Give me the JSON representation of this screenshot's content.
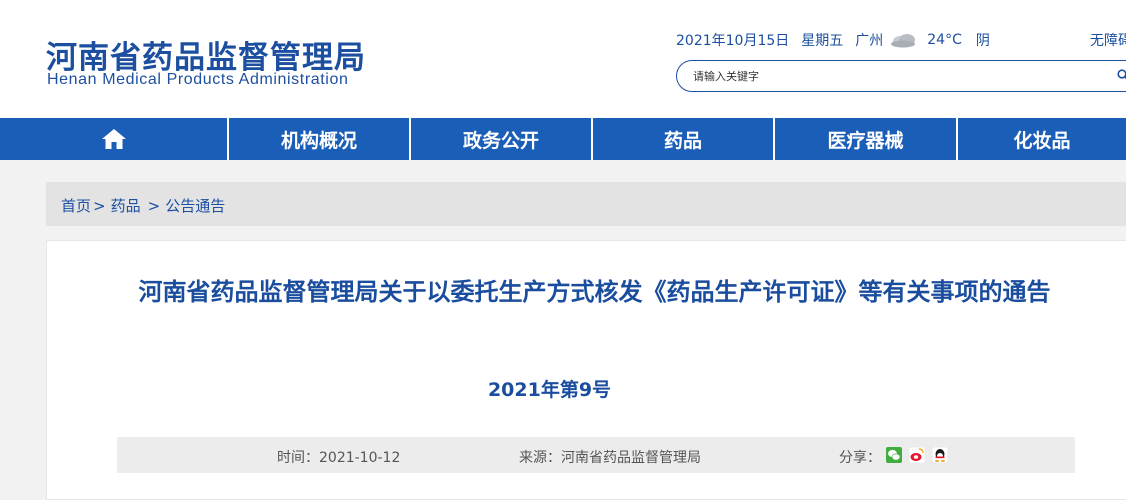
{
  "header": {
    "logo_cn": "河南省药品监督管理局",
    "logo_en": "Henan Medical Products Administration",
    "date": "2021年10月15日",
    "weekday": "星期五",
    "city": "广州",
    "weather_icon": "cloudy-icon",
    "temperature": "24°C",
    "weather": "阴",
    "accessibility": "无障碍",
    "search_placeholder": "请输入关键字",
    "search_icon": "search-icon"
  },
  "nav": {
    "home_icon": "home-icon",
    "items": [
      "机构概况",
      "政务公开",
      "药品",
      "医疗器械",
      "化妆品"
    ]
  },
  "breadcrumb": {
    "home": "首页",
    "sep1": ">",
    "level1": "药品",
    "sep2": ">",
    "level2": "公告通告"
  },
  "article": {
    "title": "河南省药品监督管理局关于以委托生产方式核发《药品生产许可证》等有关事项的通告",
    "doc_number": "2021年第9号",
    "time": "时间：2021-10-12",
    "source": "来源：河南省药品监督管理局",
    "share_label": "分享：",
    "share_icons": [
      "wechat-icon",
      "weibo-icon",
      "qq-icon"
    ]
  },
  "colors": {
    "brand_blue": "#1c4fa0",
    "nav_blue": "#1b5eb8",
    "page_bg": "#f2f2f2"
  }
}
